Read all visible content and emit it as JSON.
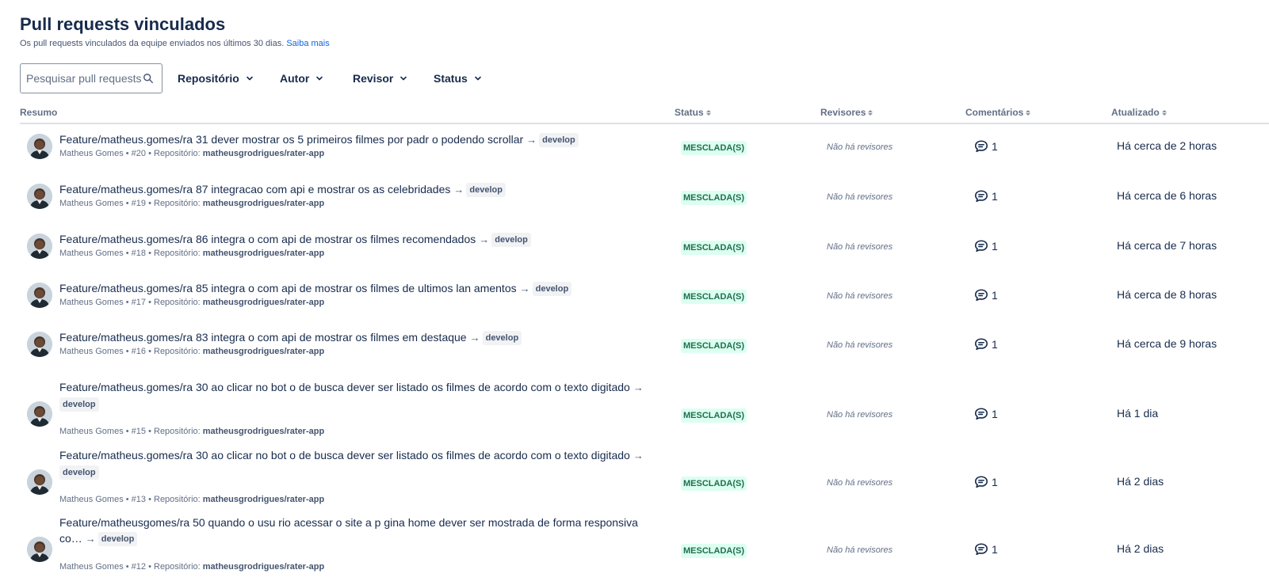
{
  "header": {
    "title": "Pull requests vinculados",
    "subtitle": "Os pull requests vinculados da equipe enviados nos últimos 30 dias.",
    "learn_more": "Saiba mais"
  },
  "search": {
    "placeholder": "Pesquisar pull requests"
  },
  "filters": [
    "Repositório",
    "Autor",
    "Revisor",
    "Status"
  ],
  "columns": [
    "Resumo",
    "Status",
    "Revisores",
    "Comentários",
    "Atualizado"
  ],
  "icons": {
    "search": "search-icon",
    "chevron": "chevron-down-icon",
    "comment": "comment-icon",
    "arrow": "arrow-right-icon"
  },
  "colors": {
    "link": "#0c66e4",
    "status_bg": "#dcfff1",
    "status_text": "#216e4e"
  },
  "rows": [
    {
      "title": "Feature/matheus.gomes/ra 31 dever mostrar os 5 primeiros filmes por padr o podendo scrollar",
      "arrow": "→",
      "branch": "develop",
      "author": "Matheus Gomes",
      "number": "#20",
      "repo_label": "Repositório:",
      "repo": "matheusgrodrigues/rater-app",
      "status": "MESCLADA(S)",
      "reviewers": "Não há revisores",
      "comments": "1",
      "updated": "Há cerca de 2 horas"
    },
    {
      "title": "Feature/matheus.gomes/ra 87 integracao com api e mostrar os as celebridades",
      "arrow": "→",
      "branch": "develop",
      "author": "Matheus Gomes",
      "number": "#19",
      "repo_label": "Repositório:",
      "repo": "matheusgrodrigues/rater-app",
      "status": "MESCLADA(S)",
      "reviewers": "Não há revisores",
      "comments": "1",
      "updated": "Há cerca de 6 horas"
    },
    {
      "title": "Feature/matheus.gomes/ra 86 integra o com api de mostrar os filmes recomendados",
      "arrow": "→",
      "branch": "develop",
      "author": "Matheus Gomes",
      "number": "#18",
      "repo_label": "Repositório:",
      "repo": "matheusgrodrigues/rater-app",
      "status": "MESCLADA(S)",
      "reviewers": "Não há revisores",
      "comments": "1",
      "updated": "Há cerca de 7 horas"
    },
    {
      "title": "Feature/matheus.gomes/ra 85 integra o com api de mostrar os filmes de ultimos lan amentos",
      "arrow": "→",
      "branch": "develop",
      "author": "Matheus Gomes",
      "number": "#17",
      "repo_label": "Repositório:",
      "repo": "matheusgrodrigues/rater-app",
      "status": "MESCLADA(S)",
      "reviewers": "Não há revisores",
      "comments": "1",
      "updated": "Há cerca de 8 horas"
    },
    {
      "title": "Feature/matheus.gomes/ra 83 integra o com api de mostrar os filmes em destaque",
      "arrow": "→",
      "branch": "develop",
      "author": "Matheus Gomes",
      "number": "#16",
      "repo_label": "Repositório:",
      "repo": "matheusgrodrigues/rater-app",
      "status": "MESCLADA(S)",
      "reviewers": "Não há revisores",
      "comments": "1",
      "updated": "Há cerca de 9 horas"
    },
    {
      "title": "Feature/matheus.gomes/ra 30 ao clicar no bot o de busca dever ser listado os filmes de acordo com o texto digitado",
      "arrow": "→",
      "branch": "develop",
      "author": "Matheus Gomes",
      "number": "#15",
      "repo_label": "Repositório:",
      "repo": "matheusgrodrigues/rater-app",
      "status": "MESCLADA(S)",
      "reviewers": "Não há revisores",
      "comments": "1",
      "updated": "Há 1 dia"
    },
    {
      "title": "Feature/matheus.gomes/ra 30 ao clicar no bot o de busca dever ser listado os filmes de acordo com o texto digitado",
      "arrow": "→",
      "branch": "develop",
      "author": "Matheus Gomes",
      "number": "#13",
      "repo_label": "Repositório:",
      "repo": "matheusgrodrigues/rater-app",
      "status": "MESCLADA(S)",
      "reviewers": "Não há revisores",
      "comments": "1",
      "updated": "Há 2 dias"
    },
    {
      "title": "Feature/matheusgomes/ra 50 quando o usu rio acessar o site a p gina home dever ser mostrada de forma responsiva co…",
      "arrow": "→",
      "branch": "develop",
      "author": "Matheus Gomes",
      "number": "#12",
      "repo_label": "Repositório:",
      "repo": "matheusgrodrigues/rater-app",
      "status": "MESCLADA(S)",
      "reviewers": "Não há revisores",
      "comments": "1",
      "updated": "Há 2 dias"
    }
  ]
}
